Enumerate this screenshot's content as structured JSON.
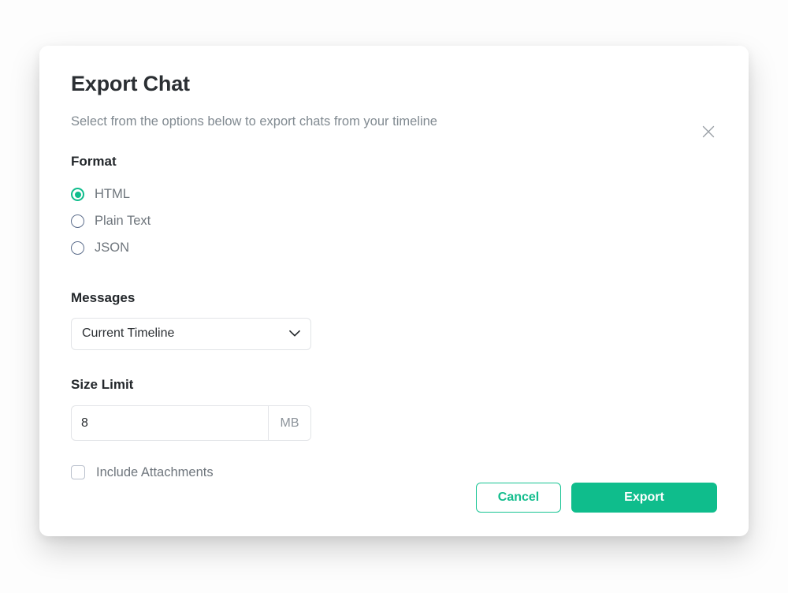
{
  "dialog": {
    "title": "Export Chat",
    "subtitle": "Select from the options below to export chats from your timeline",
    "close_icon": "close-icon"
  },
  "format": {
    "heading": "Format",
    "options": [
      {
        "label": "HTML",
        "selected": true
      },
      {
        "label": "Plain Text",
        "selected": false
      },
      {
        "label": "JSON",
        "selected": false
      }
    ]
  },
  "messages": {
    "heading": "Messages",
    "selected": "Current Timeline",
    "chevron_icon": "chevron-down-icon"
  },
  "size_limit": {
    "heading": "Size Limit",
    "value": "8",
    "placeholder": "8",
    "unit": "MB"
  },
  "attachments": {
    "label": "Include Attachments",
    "checked": false
  },
  "footer": {
    "cancel_label": "Cancel",
    "export_label": "Export"
  },
  "colors": {
    "accent_green": "#0fbd8c",
    "cancel_border": "#18c494",
    "radio_unselected": "#5d6e8c",
    "checkbox_border": "#b9c0cc",
    "heading_text": "#23272b",
    "muted_text": "#6e757c",
    "subtitle_text": "#818a91",
    "field_border": "#e2e4e7",
    "modal_background": "#ffffff"
  }
}
